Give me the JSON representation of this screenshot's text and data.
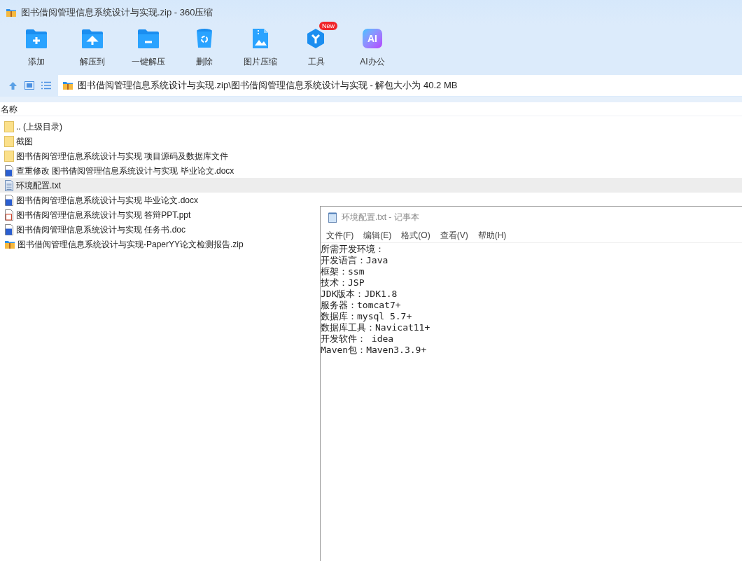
{
  "window": {
    "title": "图书借阅管理信息系统设计与实现.zip - 360压缩"
  },
  "toolbar": [
    {
      "kind": "add",
      "label": "添加"
    },
    {
      "kind": "extract-to",
      "label": "解压到"
    },
    {
      "kind": "one-click",
      "label": "一键解压"
    },
    {
      "kind": "delete",
      "label": "删除"
    },
    {
      "kind": "image",
      "label": "图片压缩"
    },
    {
      "kind": "tools",
      "label": "工具",
      "badge": "New"
    },
    {
      "kind": "ai",
      "label": "AI办公",
      "icon_text": "AI"
    }
  ],
  "address_bar": {
    "path": "图书借阅管理信息系统设计与实现.zip\\图书借阅管理信息系统设计与实现 - 解包大小为 40.2 MB"
  },
  "file_list": {
    "columns": [
      "名称"
    ],
    "rows": [
      {
        "kind": "folder",
        "name": ".. (上级目录)",
        "selected": false
      },
      {
        "kind": "folder",
        "name": "截图",
        "selected": false
      },
      {
        "kind": "folder",
        "name": "图书借阅管理信息系统设计与实现 项目源码及数据库文件",
        "selected": false
      },
      {
        "kind": "word",
        "name": "查重修改 图书借阅管理信息系统设计与实现 毕业论文.docx",
        "selected": false
      },
      {
        "kind": "text",
        "name": "环境配置.txt",
        "selected": true
      },
      {
        "kind": "word",
        "name": "图书借阅管理信息系统设计与实现 毕业论文.docx",
        "selected": false
      },
      {
        "kind": "ppt",
        "name": "图书借阅管理信息系统设计与实现 答辩PPT.ppt",
        "selected": false
      },
      {
        "kind": "word",
        "name": "图书借阅管理信息系统设计与实现 任务书.doc",
        "selected": false
      },
      {
        "kind": "zip",
        "name": "图书借阅管理信息系统设计与实现-PaperYY论文检测报告.zip",
        "selected": false
      }
    ]
  },
  "notepad": {
    "title": "环境配置.txt - 记事本",
    "menu": [
      "文件(F)",
      "编辑(E)",
      "格式(O)",
      "查看(V)",
      "帮助(H)"
    ],
    "lines": [
      "所需开发环境：",
      "开发语言：Java",
      "框架：ssm",
      "技术：JSP",
      "JDK版本：JDK1.8",
      "服务器：tomcat7+",
      "数据库：mysql 5.7+",
      "数据库工具：Navicat11+",
      "开发软件： idea",
      "Maven包：Maven3.3.9+"
    ]
  }
}
